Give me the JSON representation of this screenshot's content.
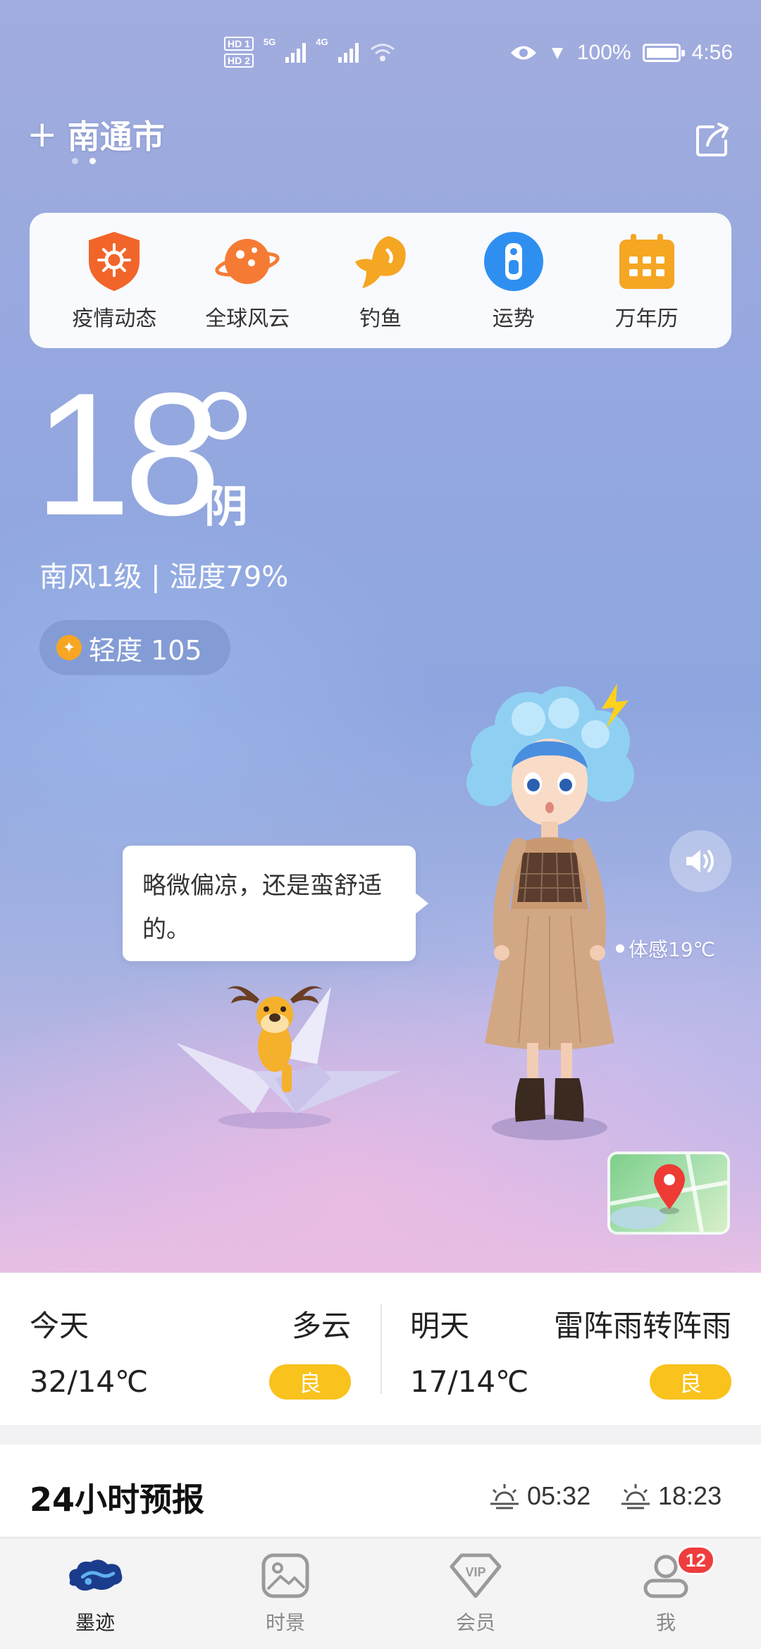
{
  "status_bar": {
    "sim1": "HD 1",
    "sim2": "HD 2",
    "net1": "5G",
    "net2": "4G",
    "battery_text": "100%",
    "time": "4:56"
  },
  "header": {
    "city": "南通市",
    "add_icon": "plus-icon",
    "share_icon": "share-icon"
  },
  "tools": [
    {
      "label": "疫情动态",
      "icon": "virus-shield-icon",
      "color": "#f2652a"
    },
    {
      "label": "全球风云",
      "icon": "planet-icon",
      "color": "#f57b34"
    },
    {
      "label": "钓鱼",
      "icon": "fish-icon",
      "color": "#f5a623"
    },
    {
      "label": "运势",
      "icon": "fortune-icon",
      "color": "#2f8ff0"
    },
    {
      "label": "万年历",
      "icon": "calendar-icon",
      "color": "#f5a623"
    }
  ],
  "current": {
    "temperature": "18",
    "condition": "阴",
    "wind_humidity": "南风1级 | 湿度79%",
    "aqi": "轻度 105"
  },
  "assistant": {
    "bubble": "略微偏凉，还是蛮舒适的。",
    "feels_like": "体感19℃"
  },
  "today": {
    "label": "今天",
    "condition": "多云",
    "temp": "32/14℃",
    "aqi": "良"
  },
  "tomorrow": {
    "label": "明天",
    "condition": "雷阵雨转阵雨",
    "temp": "17/14℃",
    "aqi": "良"
  },
  "forecast": {
    "title": "24小时预报",
    "sunrise": "05:32",
    "sunset": "18:23"
  },
  "nav": {
    "items": [
      {
        "label": "墨迹",
        "icon": "moji-cloud-icon"
      },
      {
        "label": "时景",
        "icon": "photo-icon"
      },
      {
        "label": "会员",
        "icon": "vip-diamond-icon"
      },
      {
        "label": "我",
        "icon": "user-icon"
      }
    ],
    "badge": "12"
  },
  "colors": {
    "accent_yellow": "#f9c21c",
    "badge_red": "#ef3d3d"
  }
}
